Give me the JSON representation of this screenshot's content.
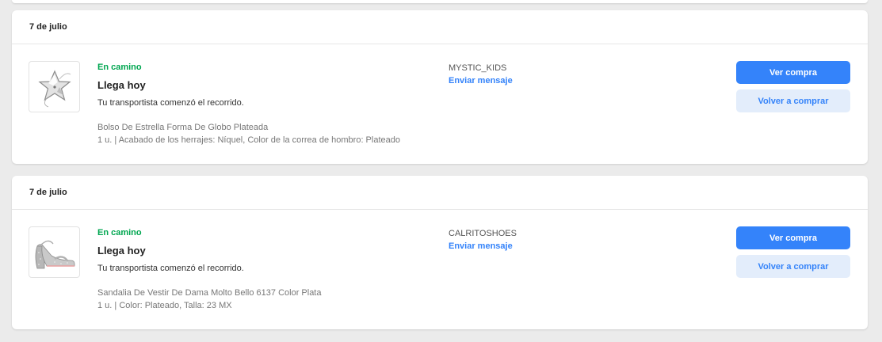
{
  "orders": [
    {
      "date": "7 de julio",
      "status": "En camino",
      "title": "Llega hoy",
      "description": "Tu transportista comenzó el recorrido.",
      "product_name": "Bolso De Estrella Forma De Globo Plateada",
      "product_detail": "1 u. | Acabado de los herrajes: Níquel, Color de la correa de hombro: Plateado",
      "seller": "MYSTIC_KIDS",
      "message_link": "Enviar mensaje",
      "view_button": "Ver compra",
      "rebuy_button": "Volver a comprar",
      "image_icon": "star-bag-icon"
    },
    {
      "date": "7 de julio",
      "status": "En camino",
      "title": "Llega hoy",
      "description": "Tu transportista comenzó el recorrido.",
      "product_name": "Sandalia De Vestir De Dama Molto Bello 6137 Color Plata",
      "product_detail": "1 u. | Color: Plateado, Talla: 23 MX",
      "seller": "CALRITOSHOES",
      "message_link": "Enviar mensaje",
      "view_button": "Ver compra",
      "rebuy_button": "Volver a comprar",
      "image_icon": "sandal-icon"
    }
  ],
  "colors": {
    "status_green": "#00a650",
    "accent_blue": "#3483fa",
    "secondary_button_bg": "#e3edfb",
    "page_bg": "#ebebeb"
  }
}
